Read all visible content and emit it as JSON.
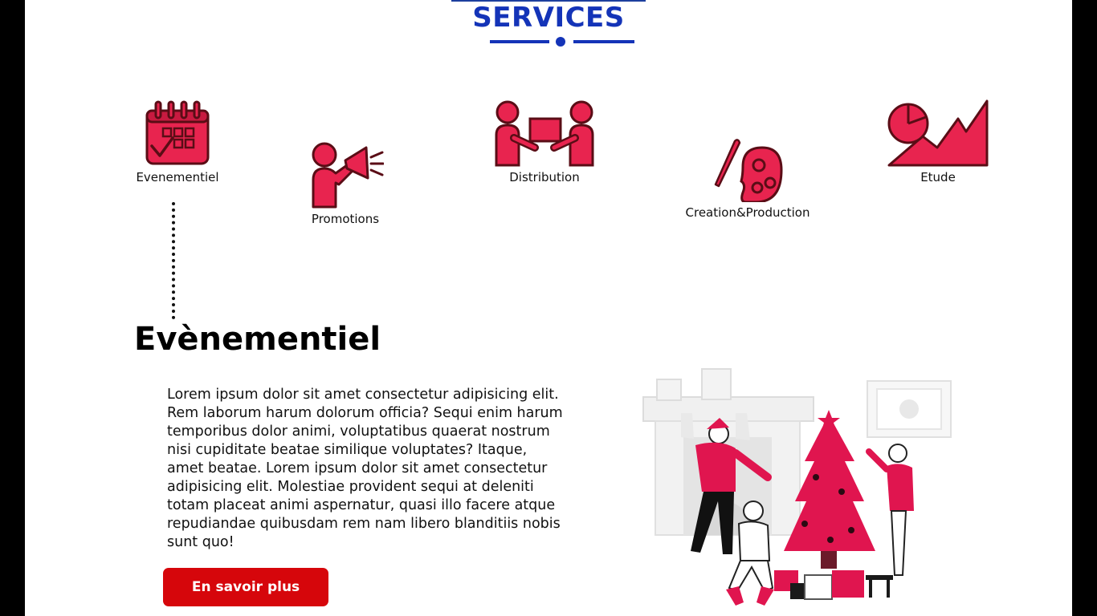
{
  "header": {
    "title": "SERVICES"
  },
  "services": [
    {
      "label": "Evenementiel",
      "icon": "calendar-icon"
    },
    {
      "label": "Promotions",
      "icon": "megaphone-icon"
    },
    {
      "label": "Distribution",
      "icon": "handover-icon"
    },
    {
      "label": "Creation&Production",
      "icon": "palette-icon"
    },
    {
      "label": "Etude",
      "icon": "chart-icon"
    }
  ],
  "detail": {
    "title": "Evènementiel",
    "text": "Lorem ipsum dolor sit amet consectetur adipisicing elit. Rem laborum harum dolorum officia? Sequi enim harum temporibus dolor animi, voluptatibus quaerat nostrum nisi cupiditate beatae similique voluptates? Itaque, amet beatae. Lorem ipsum dolor sit amet consectetur adipisicing elit. Molestiae provident sequi at deleniti totam placeat animi aspernatur, quasi illo facere atque repudiandae quibusdam rem nam libero blanditiis nobis sunt quo!",
    "button": "En savoir plus"
  },
  "colors": {
    "accent": "#e8244f",
    "outline": "#5a0d16",
    "title": "#1434b8",
    "button": "#d6060b"
  }
}
